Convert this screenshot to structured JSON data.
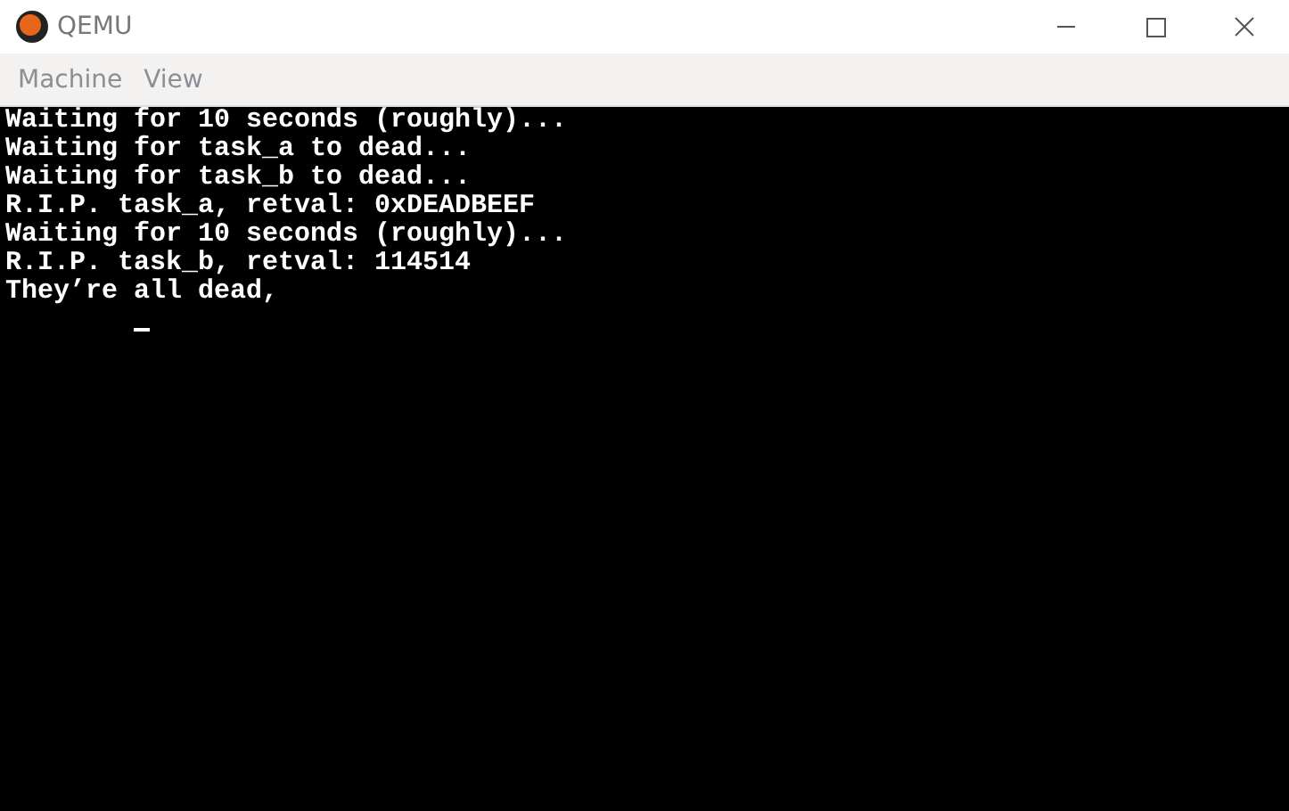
{
  "window": {
    "title": "QEMU"
  },
  "menu": [
    "Machine",
    "View"
  ],
  "console": {
    "lines": [
      "Waiting for 10 seconds (roughly)...",
      "Waiting for task_a to dead...",
      "Waiting for task_b to dead...",
      "R.I.P. task_a, retval: 0xDEADBEEF",
      "Waiting for 10 seconds (roughly)...",
      "R.I.P. task_b, retval: 114514",
      "They’re all dead,"
    ]
  }
}
